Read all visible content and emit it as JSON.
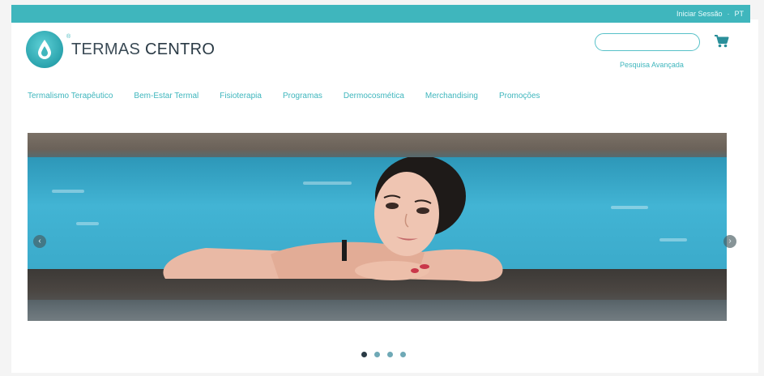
{
  "header": {
    "top_links": [
      "Iniciar Sessão",
      "PT"
    ],
    "logo": {
      "brand_light": "TERMAS",
      "brand_bold": "CENTRO",
      "registered": "®"
    },
    "search": {
      "placeholder": ""
    },
    "advanced_search": "Pesquisa Avançada"
  },
  "nav": {
    "items": [
      "Termalismo Terapêutico",
      "Bem-Estar Termal",
      "Fisioterapia",
      "Programas",
      "Dermocosmética",
      "Merchandising",
      "Promoções"
    ]
  },
  "carousel": {
    "prev_symbol": "‹",
    "next_symbol": "›",
    "slide_count": 4,
    "active_index": 0
  },
  "colors": {
    "accent": "#3fb6bd",
    "text_dark": "#2a3a45"
  }
}
